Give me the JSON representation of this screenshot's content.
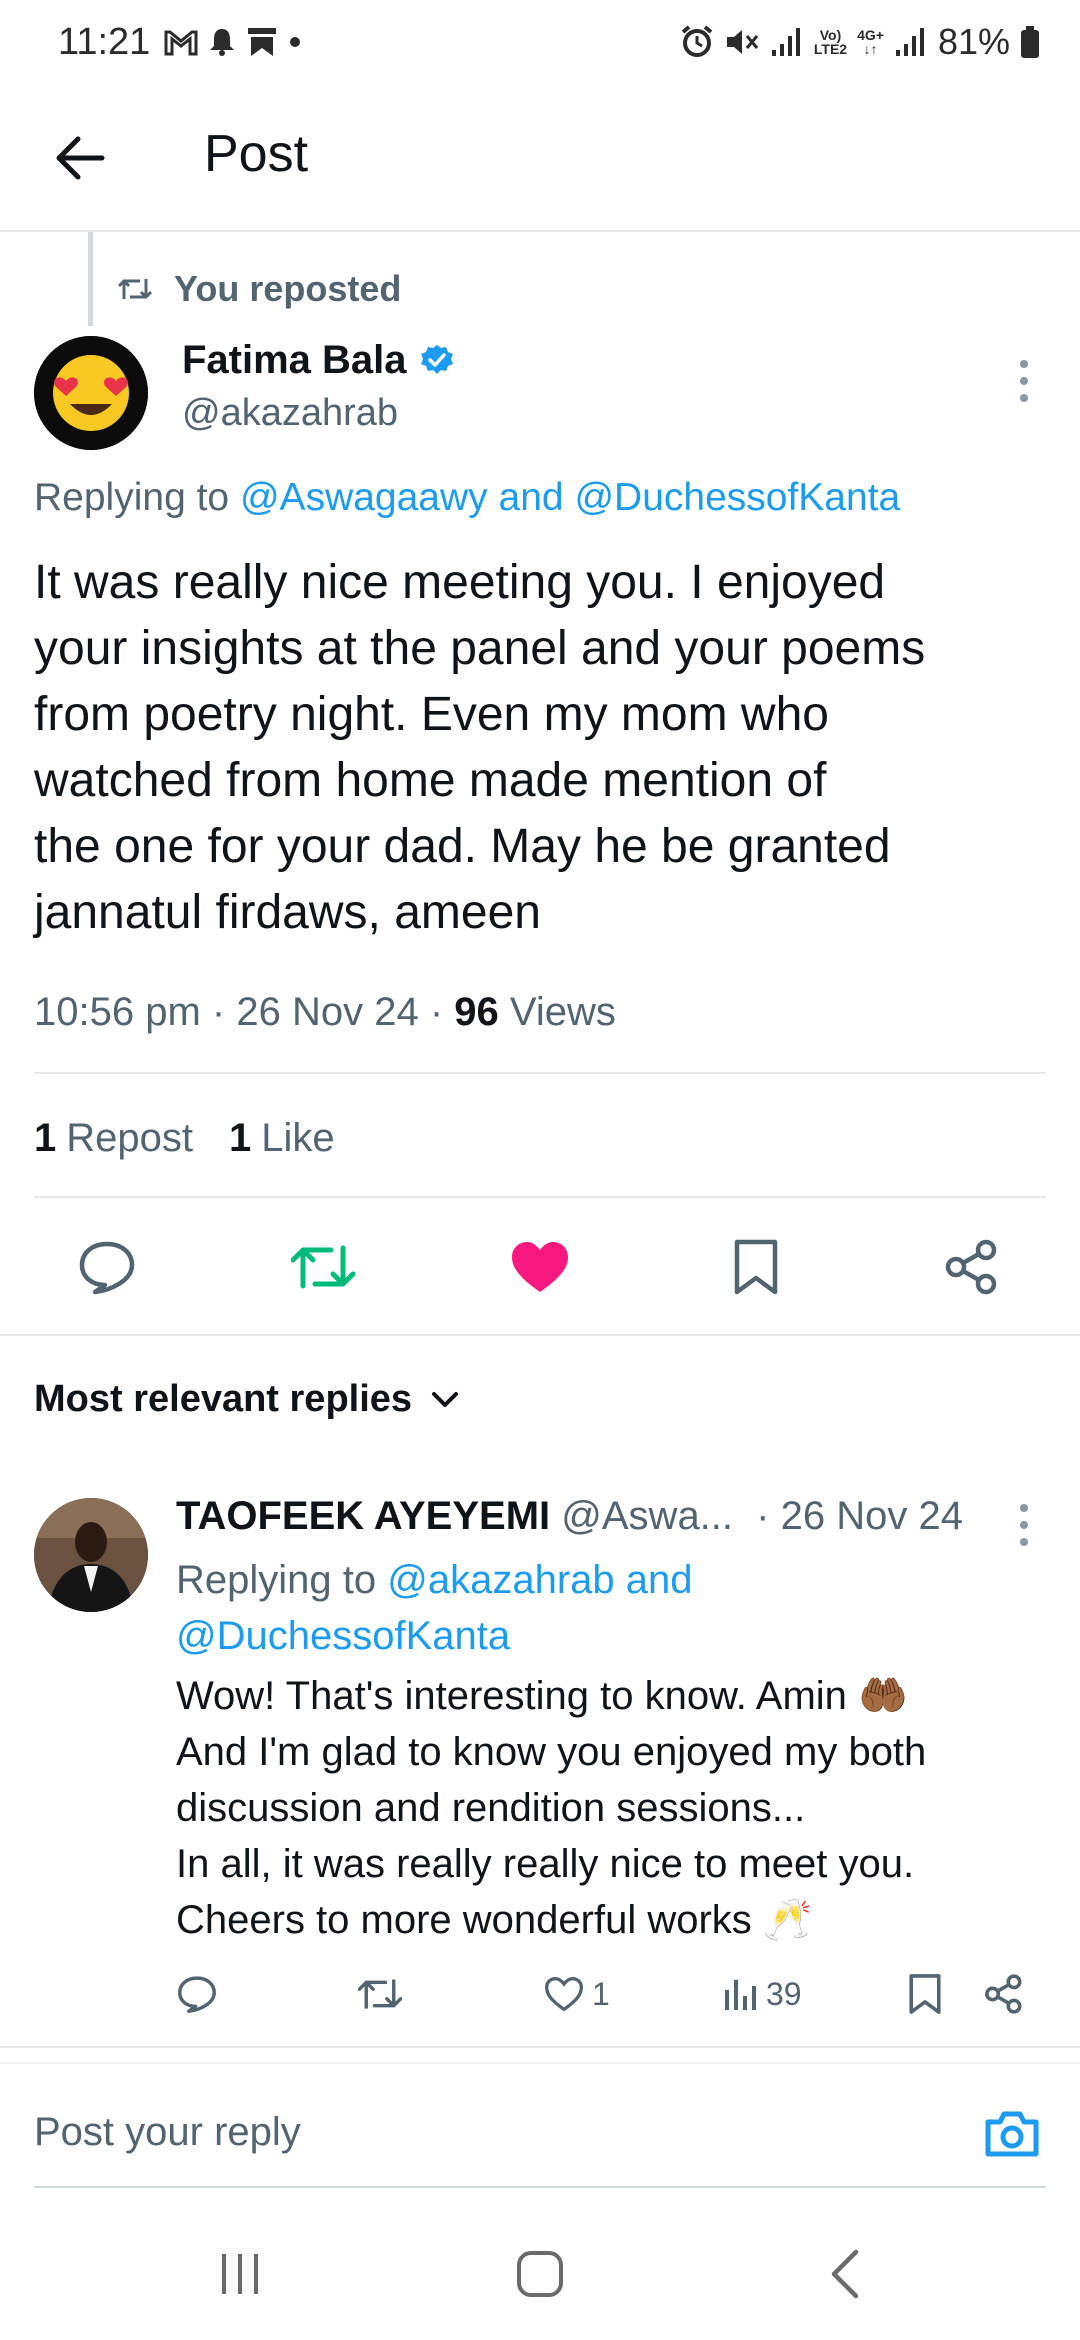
{
  "status_bar": {
    "time": "11:21",
    "network_label_top": "Vo)",
    "network_label_bottom": "LTE2",
    "network_4g": "4G+",
    "battery": "81%"
  },
  "header": {
    "title": "Post"
  },
  "post": {
    "repost_context": "You reposted",
    "author_name": "Fatima Bala",
    "author_handle": "@akazahrab",
    "replying_prefix": "Replying to",
    "replying_user1": "@Aswagaawy",
    "replying_and": "and",
    "replying_user2": "@DuchessofKanta",
    "text": "It was really nice meeting you. I enjoyed\nyour insights at the panel and your poems\nfrom poetry night. Even my mom who\nwatched from home made mention of\nthe one for your dad. May he be granted\njannatul firdaws, ameen",
    "time": "10:56 pm",
    "date": "26 Nov 24",
    "views_count": "96",
    "views_label": "Views",
    "separator": "·",
    "repost_count": "1",
    "repost_label": "Repost",
    "like_count": "1",
    "like_label": "Like"
  },
  "colors": {
    "accent": "#1d9bf0",
    "repost_green": "#00ba7c",
    "like_pink": "#f91880",
    "secondary_text": "#536471"
  },
  "sort": {
    "label": "Most relevant replies"
  },
  "reply": {
    "author_name": "TAOFEEK AYEYEMI",
    "author_handle": "@Aswa...",
    "date": "· 26 Nov 24",
    "replying_prefix": "Replying to",
    "replying_user1": "@akazahrab",
    "replying_and": "and",
    "replying_user2": "@DuchessofKanta",
    "text": "Wow! That's interesting to know. Amin 🤲🏾\nAnd I'm glad to know you enjoyed my both\ndiscussion and rendition sessions...\nIn all, it was really really nice to meet you.\nCheers to more wonderful works 🥂",
    "like_count": "1",
    "views_count": "39"
  },
  "composer": {
    "placeholder": "Post your reply"
  },
  "icons": {
    "back": "arrow-left-icon",
    "repost": "repost-icon",
    "verified": "verified-badge-icon",
    "more": "more-vertical-icon",
    "reply": "comment-icon",
    "like": "heart-icon",
    "bookmark": "bookmark-icon",
    "share": "share-icon",
    "views": "views-chart-icon",
    "camera": "camera-icon",
    "chevron": "chevron-down-icon"
  }
}
